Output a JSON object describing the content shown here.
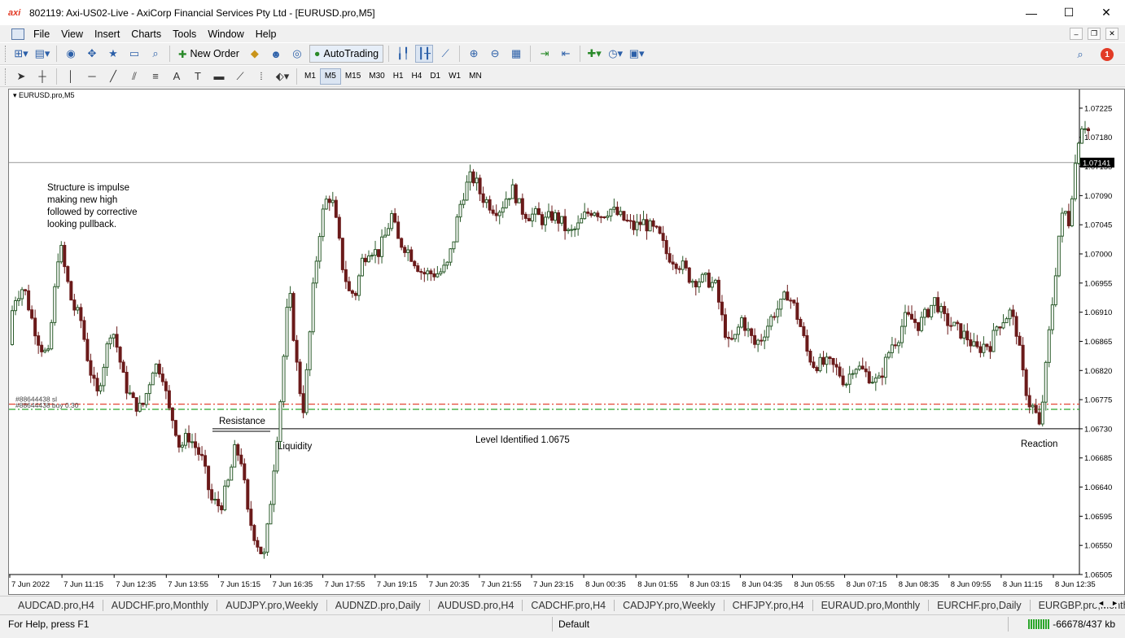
{
  "window": {
    "app_icon": "axi",
    "title": "802119: Axi-US02-Live - AxiCorp Financial Services Pty Ltd - [EURUSD.pro,M5]",
    "minimize": "—",
    "maximize": "☐",
    "close": "✕"
  },
  "menu": {
    "items": [
      "File",
      "View",
      "Insert",
      "Charts",
      "Tools",
      "Window",
      "Help"
    ]
  },
  "toolbar": {
    "new_order": "New Order",
    "autotrading": "AutoTrading",
    "timeframes": [
      "M1",
      "M5",
      "M15",
      "M30",
      "H1",
      "H4",
      "D1",
      "W1",
      "MN"
    ],
    "active_timeframe": "M5",
    "notification_count": "1"
  },
  "chart": {
    "label": "EURUSD.pro,M5",
    "colors": {
      "bull": "#2a5a2a",
      "bear": "#6b1a1a",
      "grid_line": "#9a9a9a",
      "red_dash": "#e0301e",
      "green_dash": "#2aa52a",
      "price_tag_bg": "#000000"
    }
  },
  "chart_data": {
    "type": "candlestick",
    "symbol": "EURUSD.pro",
    "timeframe": "M5",
    "ylim": [
      1.06505,
      1.07245
    ],
    "y_ticks": [
      "1.07225",
      "1.07180",
      "1.07135",
      "1.07090",
      "1.07045",
      "1.07000",
      "1.06955",
      "1.06910",
      "1.06865",
      "1.06820",
      "1.06775",
      "1.06730",
      "1.06685",
      "1.06640",
      "1.06595",
      "1.06550",
      "1.06505"
    ],
    "x_ticks": [
      "7 Jun 2022",
      "7 Jun 11:15",
      "7 Jun 12:35",
      "7 Jun 13:55",
      "7 Jun 15:15",
      "7 Jun 16:35",
      "7 Jun 17:55",
      "7 Jun 19:15",
      "7 Jun 20:35",
      "7 Jun 21:55",
      "7 Jun 23:15",
      "8 Jun 00:35",
      "8 Jun 01:55",
      "8 Jun 03:15",
      "8 Jun 04:35",
      "8 Jun 05:55",
      "8 Jun 07:15",
      "8 Jun 08:35",
      "8 Jun 09:55",
      "8 Jun 11:15",
      "8 Jun 12:35"
    ],
    "current_price": "1.07141",
    "horizontal_lines": {
      "gray_level_price": 1.07141,
      "level_identified_price": 1.0673,
      "red_dash_price": 1.06768,
      "green_dash_price": 1.0676
    },
    "order_labels": [
      "#88644438 sl",
      "#88644438 buy 0.30"
    ],
    "annotations": {
      "structure": [
        "Structure is impulse",
        "making new high",
        "followed by corrective",
        "looking pullback."
      ],
      "resistance": "Resistance",
      "liquidity": "Liquidity",
      "level": "Level Identified 1.0675",
      "reaction": "Reaction"
    },
    "price_path": [
      [
        0,
        1.0686
      ],
      [
        8,
        1.0693
      ],
      [
        20,
        1.0695
      ],
      [
        30,
        1.069
      ],
      [
        40,
        1.0686
      ],
      [
        50,
        1.0684
      ],
      [
        58,
        1.0694
      ],
      [
        64,
        1.0702
      ],
      [
        70,
        1.0698
      ],
      [
        80,
        1.0692
      ],
      [
        90,
        1.069
      ],
      [
        100,
        1.0683
      ],
      [
        110,
        1.0678
      ],
      [
        120,
        1.0684
      ],
      [
        128,
        1.0689
      ],
      [
        136,
        1.0685
      ],
      [
        144,
        1.068
      ],
      [
        155,
        1.0677
      ],
      [
        165,
        1.0676
      ],
      [
        172,
        1.0679
      ],
      [
        180,
        1.0683
      ],
      [
        190,
        1.0682
      ],
      [
        198,
        1.0676
      ],
      [
        205,
        1.0674
      ],
      [
        212,
        1.067
      ],
      [
        222,
        1.0672
      ],
      [
        232,
        1.067
      ],
      [
        240,
        1.0668
      ],
      [
        250,
        1.0662
      ],
      [
        262,
        1.0661
      ],
      [
        272,
        1.0665
      ],
      [
        280,
        1.067
      ],
      [
        288,
        1.0668
      ],
      [
        295,
        1.066
      ],
      [
        305,
        1.0656
      ],
      [
        315,
        1.0653
      ],
      [
        322,
        1.066
      ],
      [
        328,
        1.0668
      ],
      [
        334,
        1.0675
      ],
      [
        340,
        1.0685
      ],
      [
        346,
        1.0695
      ],
      [
        352,
        1.0687
      ],
      [
        358,
        1.068
      ],
      [
        364,
        1.0676
      ],
      [
        370,
        1.0685
      ],
      [
        376,
        1.0695
      ],
      [
        383,
        1.0703
      ],
      [
        390,
        1.0708
      ],
      [
        398,
        1.0709
      ],
      [
        405,
        1.0704
      ],
      [
        412,
        1.0698
      ],
      [
        420,
        1.0694
      ],
      [
        428,
        1.0694
      ],
      [
        436,
        1.0699
      ],
      [
        445,
        1.0701
      ],
      [
        455,
        1.07
      ],
      [
        465,
        1.0703
      ],
      [
        472,
        1.0706
      ],
      [
        480,
        1.0702
      ],
      [
        490,
        1.0701
      ],
      [
        500,
        1.0699
      ],
      [
        510,
        1.0697
      ],
      [
        520,
        1.0697
      ],
      [
        530,
        1.0697
      ],
      [
        540,
        1.0698
      ],
      [
        548,
        1.0702
      ],
      [
        555,
        1.0707
      ],
      [
        562,
        1.071
      ],
      [
        570,
        1.0712
      ],
      [
        576,
        1.0711
      ],
      [
        582,
        1.0709
      ],
      [
        590,
        1.0708
      ],
      [
        598,
        1.0707
      ],
      [
        606,
        1.0707
      ],
      [
        614,
        1.0709
      ],
      [
        622,
        1.071
      ],
      [
        630,
        1.0707
      ],
      [
        640,
        1.0706
      ],
      [
        650,
        1.0706
      ],
      [
        660,
        1.0705
      ],
      [
        670,
        1.0706
      ],
      [
        680,
        1.0705
      ],
      [
        690,
        1.0703
      ],
      [
        700,
        1.0704
      ],
      [
        710,
        1.0706
      ],
      [
        720,
        1.0707
      ],
      [
        730,
        1.0706
      ],
      [
        740,
        1.0707
      ],
      [
        750,
        1.0706
      ],
      [
        760,
        1.0705
      ],
      [
        770,
        1.0704
      ],
      [
        780,
        1.0705
      ],
      [
        790,
        1.0704
      ],
      [
        800,
        1.0703
      ],
      [
        810,
        1.07
      ],
      [
        820,
        1.0699
      ],
      [
        830,
        1.0698
      ],
      [
        840,
        1.0696
      ],
      [
        850,
        1.0696
      ],
      [
        860,
        1.0696
      ],
      [
        870,
        1.0695
      ],
      [
        878,
        1.069
      ],
      [
        886,
        1.0686
      ],
      [
        894,
        1.0687
      ],
      [
        902,
        1.069
      ],
      [
        910,
        1.0688
      ],
      [
        918,
        1.0686
      ],
      [
        926,
        1.0687
      ],
      [
        934,
        1.0689
      ],
      [
        942,
        1.0691
      ],
      [
        950,
        1.0692
      ],
      [
        958,
        1.0694
      ],
      [
        966,
        1.0692
      ],
      [
        974,
        1.0689
      ],
      [
        982,
        1.0685
      ],
      [
        990,
        1.0683
      ],
      [
        1000,
        1.0683
      ],
      [
        1010,
        1.0683
      ],
      [
        1020,
        1.0682
      ],
      [
        1030,
        1.068
      ],
      [
        1040,
        1.0683
      ],
      [
        1050,
        1.0682
      ],
      [
        1060,
        1.0681
      ],
      [
        1070,
        1.068
      ],
      [
        1078,
        1.0683
      ],
      [
        1086,
        1.0686
      ],
      [
        1094,
        1.0687
      ],
      [
        1102,
        1.069
      ],
      [
        1110,
        1.069
      ],
      [
        1120,
        1.0689
      ],
      [
        1130,
        1.0691
      ],
      [
        1140,
        1.0693
      ],
      [
        1150,
        1.069
      ],
      [
        1160,
        1.0689
      ],
      [
        1170,
        1.0688
      ],
      [
        1180,
        1.0687
      ],
      [
        1190,
        1.0685
      ],
      [
        1200,
        1.0686
      ],
      [
        1208,
        1.0686
      ],
      [
        1216,
        1.0689
      ],
      [
        1224,
        1.069
      ],
      [
        1232,
        1.0691
      ],
      [
        1240,
        1.0688
      ],
      [
        1248,
        1.0681
      ],
      [
        1255,
        1.0677
      ],
      [
        1262,
        1.0676
      ],
      [
        1268,
        1.0673
      ],
      [
        1274,
        1.068
      ],
      [
        1280,
        1.0688
      ],
      [
        1286,
        1.0695
      ],
      [
        1292,
        1.0703
      ],
      [
        1298,
        1.0707
      ],
      [
        1304,
        1.0705
      ],
      [
        1310,
        1.0712
      ],
      [
        1316,
        1.0718
      ],
      [
        1322,
        1.0721
      ],
      [
        1326,
        1.0719
      ]
    ],
    "candle_count": 330
  },
  "tabs": {
    "items": [
      "AUDCAD.pro,H4",
      "AUDCHF.pro,Monthly",
      "AUDJPY.pro,Weekly",
      "AUDNZD.pro,Daily",
      "AUDUSD.pro,H4",
      "CADCHF.pro,H4",
      "CADJPY.pro,Weekly",
      "CHFJPY.pro,H4",
      "EURAUD.pro,Monthly",
      "EURCHF.pro,Daily",
      "EURGBP.pro,Monthly"
    ],
    "prev": "◄",
    "next": "►"
  },
  "status": {
    "help": "For Help, press F1",
    "profile": "Default",
    "traffic": "-66678/437 kb"
  }
}
